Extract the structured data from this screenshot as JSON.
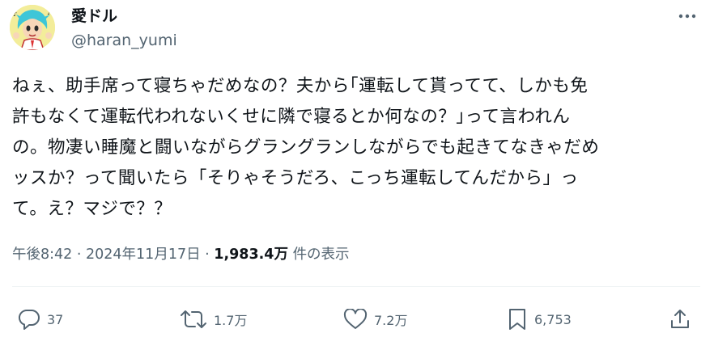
{
  "user": {
    "display_name": "愛ドル",
    "handle": "@haran_yumi",
    "avatar_icon": "anime-character-avatar"
  },
  "post": {
    "text": "ねぇ、助手席って寝ちゃだめなの？夫から｢運転して貰ってて、しかも免\n許もなくて運転代われないくせに隣で寝るとか何なの？｣って言われん\nの。物凄い睡魔と闘いながらグラングランしながらでも起きてなきゃだめ\nッスか？って聞いたら「そりゃそうだろ、こっち運転してんだから」っ\nて。え？マジで？？",
    "time": "午後8:42",
    "separator": " · ",
    "date": "2024年11月17日",
    "views_count": "1,983.4万",
    "views_label": "件の表示"
  },
  "actions": {
    "replies": "37",
    "reposts": "1.7万",
    "likes": "7.2万",
    "bookmarks": "6,753"
  },
  "colors": {
    "text": "#0f1419",
    "secondary": "#536471",
    "divider": "#eff3f4"
  }
}
